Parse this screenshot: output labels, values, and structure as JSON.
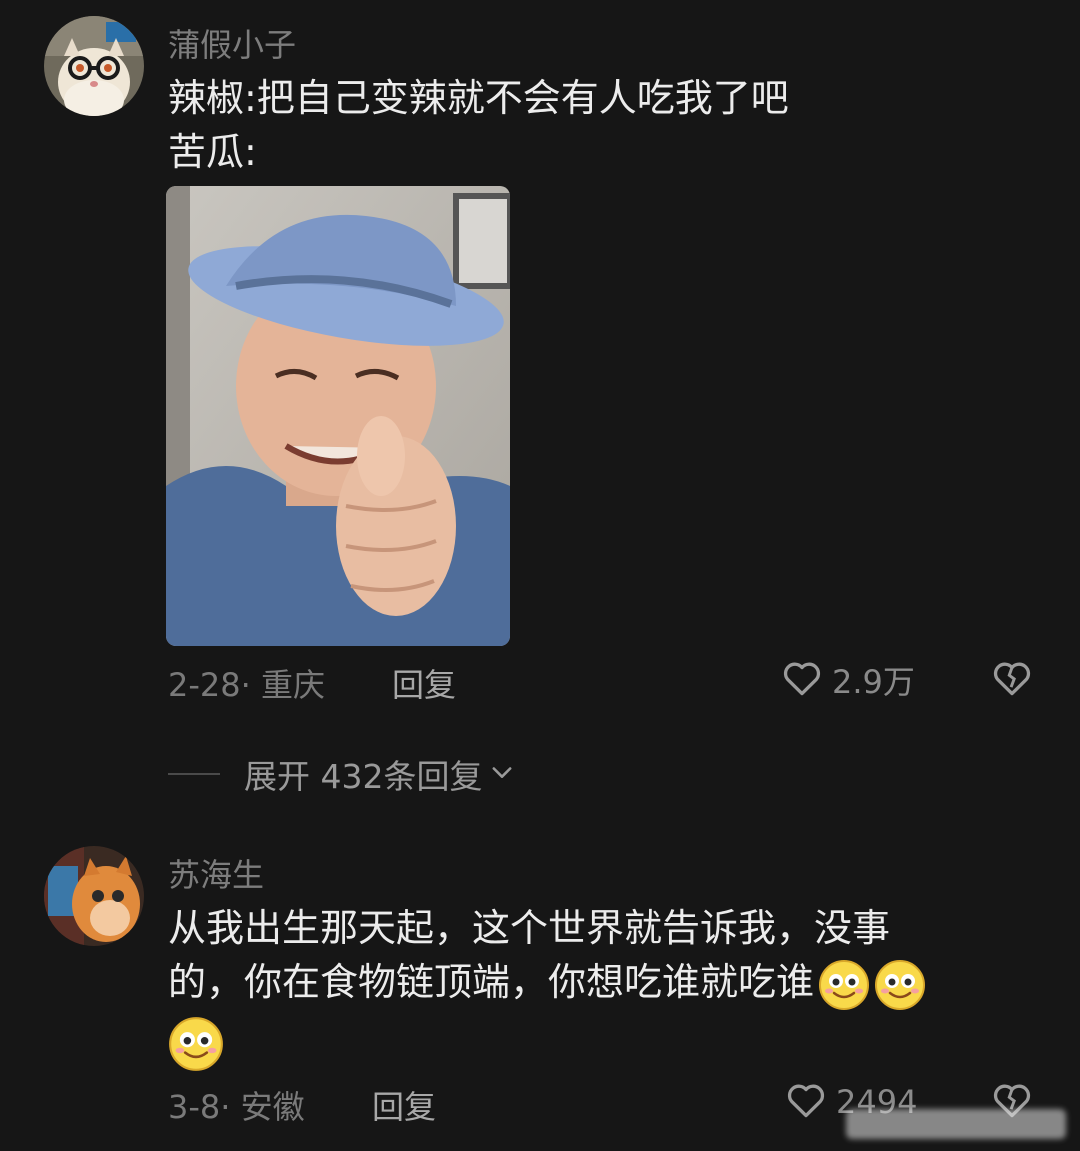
{
  "comments": [
    {
      "username": "蒲假小子",
      "text_lines": [
        "辣椒:把自己变辣就不会有人吃我了吧",
        "苦瓜:"
      ],
      "date_location": "2-28· 重庆",
      "reply_label": "回复",
      "like_count": "2.9万"
    },
    {
      "username": "苏海生",
      "text_lines": [
        "从我出生那天起，这个世界就告诉我，没事",
        "的，你在食物链顶端，你想吃谁就吃谁"
      ],
      "date_location": "3-8· 安徽",
      "reply_label": "回复",
      "like_count": "2494"
    }
  ],
  "expand_replies": {
    "label": "展开 432条回复"
  },
  "icons": {
    "like": "heart-outline-icon",
    "dislike": "broken-heart-icon",
    "expand": "chevron-down-icon",
    "emoji": "smile-emoji-icon"
  },
  "colors": {
    "background": "#161616",
    "text_primary": "#ececec",
    "text_secondary": "#7d7d7d"
  }
}
